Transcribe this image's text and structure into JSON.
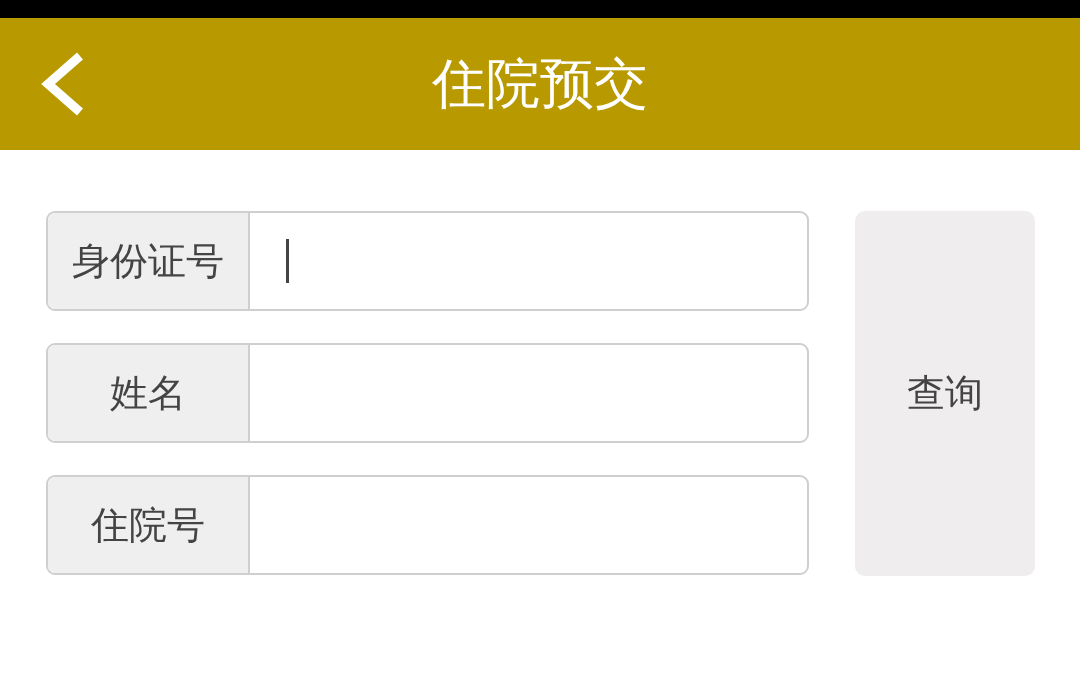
{
  "header": {
    "title": "住院预交"
  },
  "fields": [
    {
      "label": "身份证号",
      "focused": true
    },
    {
      "label": "姓名",
      "focused": false
    },
    {
      "label": "住院号",
      "focused": false
    }
  ],
  "query_button": {
    "label": "查询"
  }
}
